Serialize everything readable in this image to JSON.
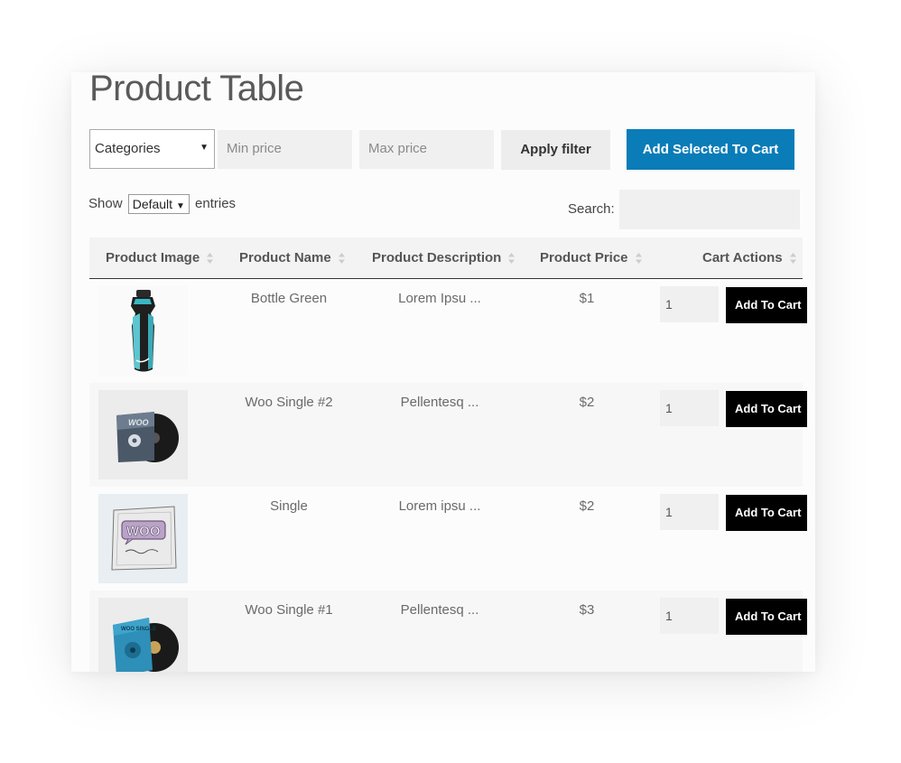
{
  "page": {
    "title": "Product Table"
  },
  "filters": {
    "categories_value": "Categories",
    "min_price_placeholder": "Min price",
    "max_price_placeholder": "Max price",
    "apply_label": "Apply filter",
    "add_selected_label": "Add Selected To Cart"
  },
  "length": {
    "show_label": "Show",
    "selected": "Default",
    "entries_label": "entries"
  },
  "search": {
    "label": "Search:",
    "value": ""
  },
  "table": {
    "columns": [
      "Product Image",
      "Product Name",
      "Product Description",
      "Product Price",
      "Cart Actions"
    ],
    "rows": [
      {
        "name": "Bottle Green",
        "description": "Lorem Ipsu ...",
        "price": "$1",
        "qty": "1",
        "action": "Add To Cart",
        "image": "water-bottle"
      },
      {
        "name": "Woo Single #2",
        "description": "Pellentesq ...",
        "price": "$2",
        "qty": "1",
        "action": "Add To Cart",
        "image": "vinyl-album-dark"
      },
      {
        "name": "Single",
        "description": "Lorem ipsu ...",
        "price": "$2",
        "qty": "1",
        "action": "Add To Cart",
        "image": "woo-single-sketch"
      },
      {
        "name": "Woo Single #1",
        "description": "Pellentesq ...",
        "price": "$3",
        "qty": "1",
        "action": "Add To Cart",
        "image": "vinyl-album-blue"
      }
    ]
  },
  "colors": {
    "primary_button": "#0a7cb8",
    "cart_button": "#000000",
    "input_bg": "#f0f0f0"
  }
}
